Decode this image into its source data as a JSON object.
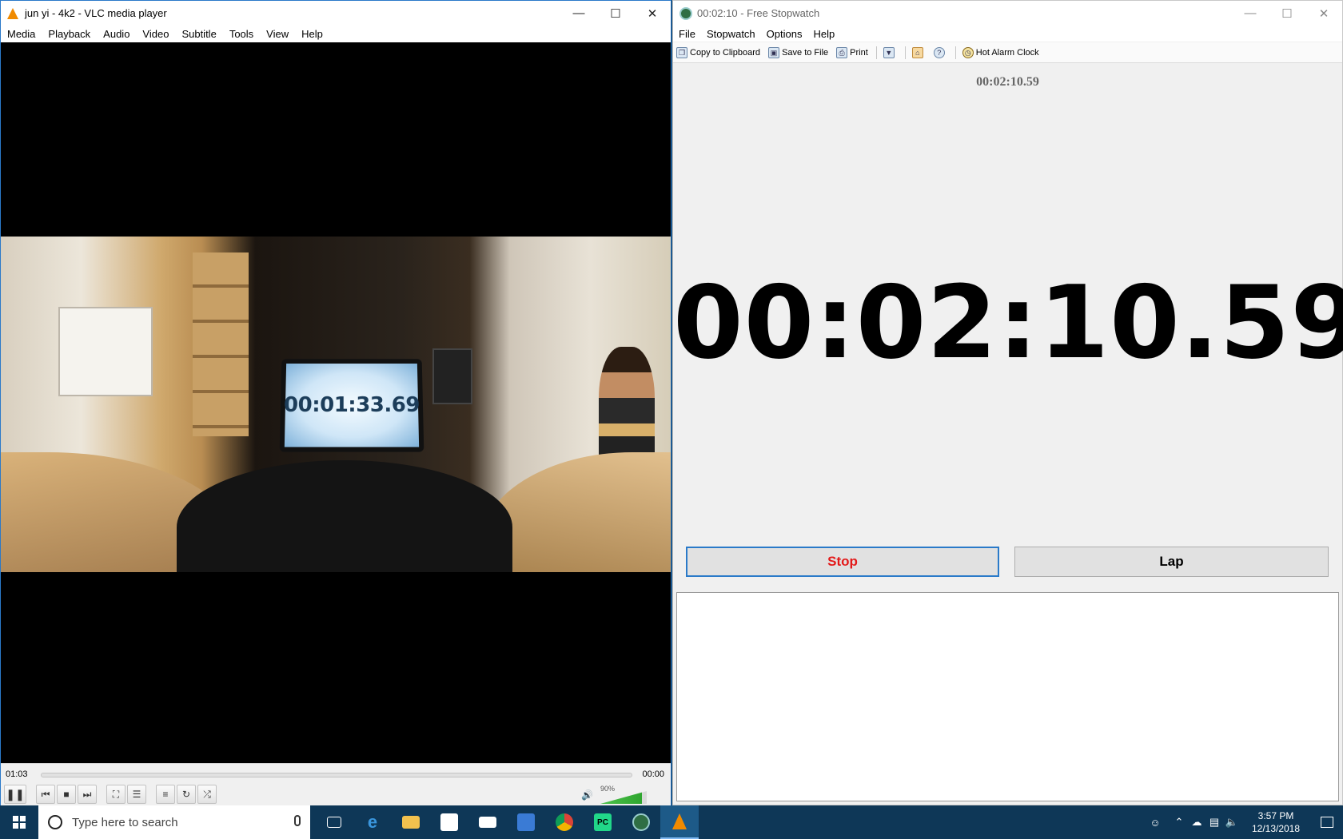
{
  "vlc": {
    "title": "jun yi - 4k2 - VLC media player",
    "menu": [
      "Media",
      "Playback",
      "Audio",
      "Video",
      "Subtitle",
      "Tools",
      "View",
      "Help"
    ],
    "video_laptop_time": "00:01:33.69",
    "elapsed": "01:03",
    "duration": "00:00",
    "seek_progress": 0.0,
    "volume_label": "90%",
    "volume_level": 0.9
  },
  "stopwatch": {
    "title": "00:02:10 - Free Stopwatch",
    "menu": [
      "File",
      "Stopwatch",
      "Options",
      "Help"
    ],
    "toolbar": {
      "copy": "Copy to Clipboard",
      "save": "Save to File",
      "print": "Print",
      "alarm": "Hot Alarm Clock"
    },
    "small_time": "00:02:10.59",
    "big_time": "00:02:10.59",
    "stop_label": "Stop",
    "lap_label": "Lap"
  },
  "taskbar": {
    "search_placeholder": "Type here to search",
    "time": "3:57 PM",
    "date": "12/13/2018"
  },
  "colors": {
    "stop_text": "#e31a1a",
    "taskbar_bg": "#0e3757",
    "accent_blue": "#2a7ac9"
  }
}
